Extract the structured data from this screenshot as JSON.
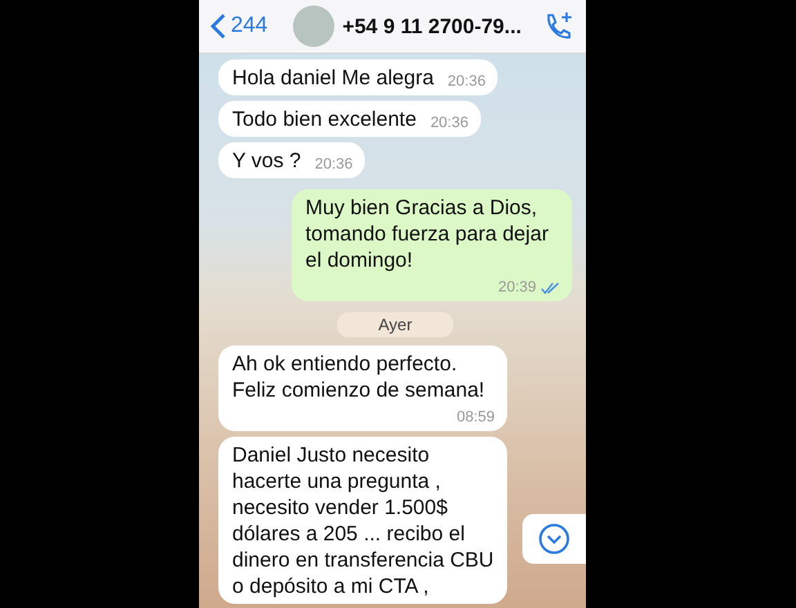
{
  "header": {
    "back_count": "244",
    "contact": "+54 9 11 2700-79..."
  },
  "messages": [
    {
      "kind": "in",
      "text": "Hola daniel Me alegra",
      "time": "20:36"
    },
    {
      "kind": "in",
      "text": "Todo bien excelente",
      "time": "20:36"
    },
    {
      "kind": "in",
      "text": "Y vos ?",
      "time": "20:36"
    },
    {
      "kind": "out",
      "text": "Muy bien Gracias a Dios, tomando fuerza para dejar el domingo!",
      "time": "20:39",
      "read": true
    },
    {
      "kind": "date",
      "text": "Ayer"
    },
    {
      "kind": "in",
      "text": "Ah ok entiendo perfecto. Feliz comienzo de semana!",
      "time": "08:59"
    },
    {
      "kind": "in",
      "text": "Daniel Justo necesito hacerte una pregunta , necesito vender 1.500$ dólares a 205 ... recibo el dinero en transferencia CBU o depósito a mi CTA ,"
    }
  ]
}
